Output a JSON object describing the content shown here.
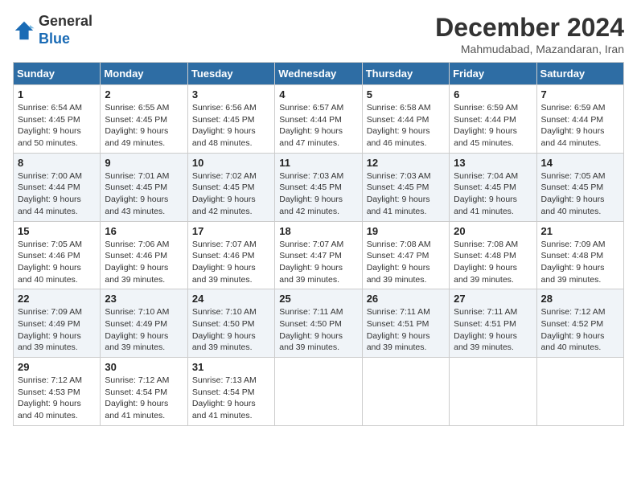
{
  "logo": {
    "line1": "General",
    "line2": "Blue"
  },
  "title": "December 2024",
  "subtitle": "Mahmudabad, Mazandaran, Iran",
  "weekdays": [
    "Sunday",
    "Monday",
    "Tuesday",
    "Wednesday",
    "Thursday",
    "Friday",
    "Saturday"
  ],
  "weeks": [
    [
      {
        "day": "1",
        "sunrise": "6:54 AM",
        "sunset": "4:45 PM",
        "daylight": "9 hours and 50 minutes."
      },
      {
        "day": "2",
        "sunrise": "6:55 AM",
        "sunset": "4:45 PM",
        "daylight": "9 hours and 49 minutes."
      },
      {
        "day": "3",
        "sunrise": "6:56 AM",
        "sunset": "4:45 PM",
        "daylight": "9 hours and 48 minutes."
      },
      {
        "day": "4",
        "sunrise": "6:57 AM",
        "sunset": "4:44 PM",
        "daylight": "9 hours and 47 minutes."
      },
      {
        "day": "5",
        "sunrise": "6:58 AM",
        "sunset": "4:44 PM",
        "daylight": "9 hours and 46 minutes."
      },
      {
        "day": "6",
        "sunrise": "6:59 AM",
        "sunset": "4:44 PM",
        "daylight": "9 hours and 45 minutes."
      },
      {
        "day": "7",
        "sunrise": "6:59 AM",
        "sunset": "4:44 PM",
        "daylight": "9 hours and 44 minutes."
      }
    ],
    [
      {
        "day": "8",
        "sunrise": "7:00 AM",
        "sunset": "4:44 PM",
        "daylight": "9 hours and 44 minutes."
      },
      {
        "day": "9",
        "sunrise": "7:01 AM",
        "sunset": "4:45 PM",
        "daylight": "9 hours and 43 minutes."
      },
      {
        "day": "10",
        "sunrise": "7:02 AM",
        "sunset": "4:45 PM",
        "daylight": "9 hours and 42 minutes."
      },
      {
        "day": "11",
        "sunrise": "7:03 AM",
        "sunset": "4:45 PM",
        "daylight": "9 hours and 42 minutes."
      },
      {
        "day": "12",
        "sunrise": "7:03 AM",
        "sunset": "4:45 PM",
        "daylight": "9 hours and 41 minutes."
      },
      {
        "day": "13",
        "sunrise": "7:04 AM",
        "sunset": "4:45 PM",
        "daylight": "9 hours and 41 minutes."
      },
      {
        "day": "14",
        "sunrise": "7:05 AM",
        "sunset": "4:45 PM",
        "daylight": "9 hours and 40 minutes."
      }
    ],
    [
      {
        "day": "15",
        "sunrise": "7:05 AM",
        "sunset": "4:46 PM",
        "daylight": "9 hours and 40 minutes."
      },
      {
        "day": "16",
        "sunrise": "7:06 AM",
        "sunset": "4:46 PM",
        "daylight": "9 hours and 39 minutes."
      },
      {
        "day": "17",
        "sunrise": "7:07 AM",
        "sunset": "4:46 PM",
        "daylight": "9 hours and 39 minutes."
      },
      {
        "day": "18",
        "sunrise": "7:07 AM",
        "sunset": "4:47 PM",
        "daylight": "9 hours and 39 minutes."
      },
      {
        "day": "19",
        "sunrise": "7:08 AM",
        "sunset": "4:47 PM",
        "daylight": "9 hours and 39 minutes."
      },
      {
        "day": "20",
        "sunrise": "7:08 AM",
        "sunset": "4:48 PM",
        "daylight": "9 hours and 39 minutes."
      },
      {
        "day": "21",
        "sunrise": "7:09 AM",
        "sunset": "4:48 PM",
        "daylight": "9 hours and 39 minutes."
      }
    ],
    [
      {
        "day": "22",
        "sunrise": "7:09 AM",
        "sunset": "4:49 PM",
        "daylight": "9 hours and 39 minutes."
      },
      {
        "day": "23",
        "sunrise": "7:10 AM",
        "sunset": "4:49 PM",
        "daylight": "9 hours and 39 minutes."
      },
      {
        "day": "24",
        "sunrise": "7:10 AM",
        "sunset": "4:50 PM",
        "daylight": "9 hours and 39 minutes."
      },
      {
        "day": "25",
        "sunrise": "7:11 AM",
        "sunset": "4:50 PM",
        "daylight": "9 hours and 39 minutes."
      },
      {
        "day": "26",
        "sunrise": "7:11 AM",
        "sunset": "4:51 PM",
        "daylight": "9 hours and 39 minutes."
      },
      {
        "day": "27",
        "sunrise": "7:11 AM",
        "sunset": "4:51 PM",
        "daylight": "9 hours and 39 minutes."
      },
      {
        "day": "28",
        "sunrise": "7:12 AM",
        "sunset": "4:52 PM",
        "daylight": "9 hours and 40 minutes."
      }
    ],
    [
      {
        "day": "29",
        "sunrise": "7:12 AM",
        "sunset": "4:53 PM",
        "daylight": "9 hours and 40 minutes."
      },
      {
        "day": "30",
        "sunrise": "7:12 AM",
        "sunset": "4:54 PM",
        "daylight": "9 hours and 41 minutes."
      },
      {
        "day": "31",
        "sunrise": "7:13 AM",
        "sunset": "4:54 PM",
        "daylight": "9 hours and 41 minutes."
      },
      null,
      null,
      null,
      null
    ]
  ]
}
